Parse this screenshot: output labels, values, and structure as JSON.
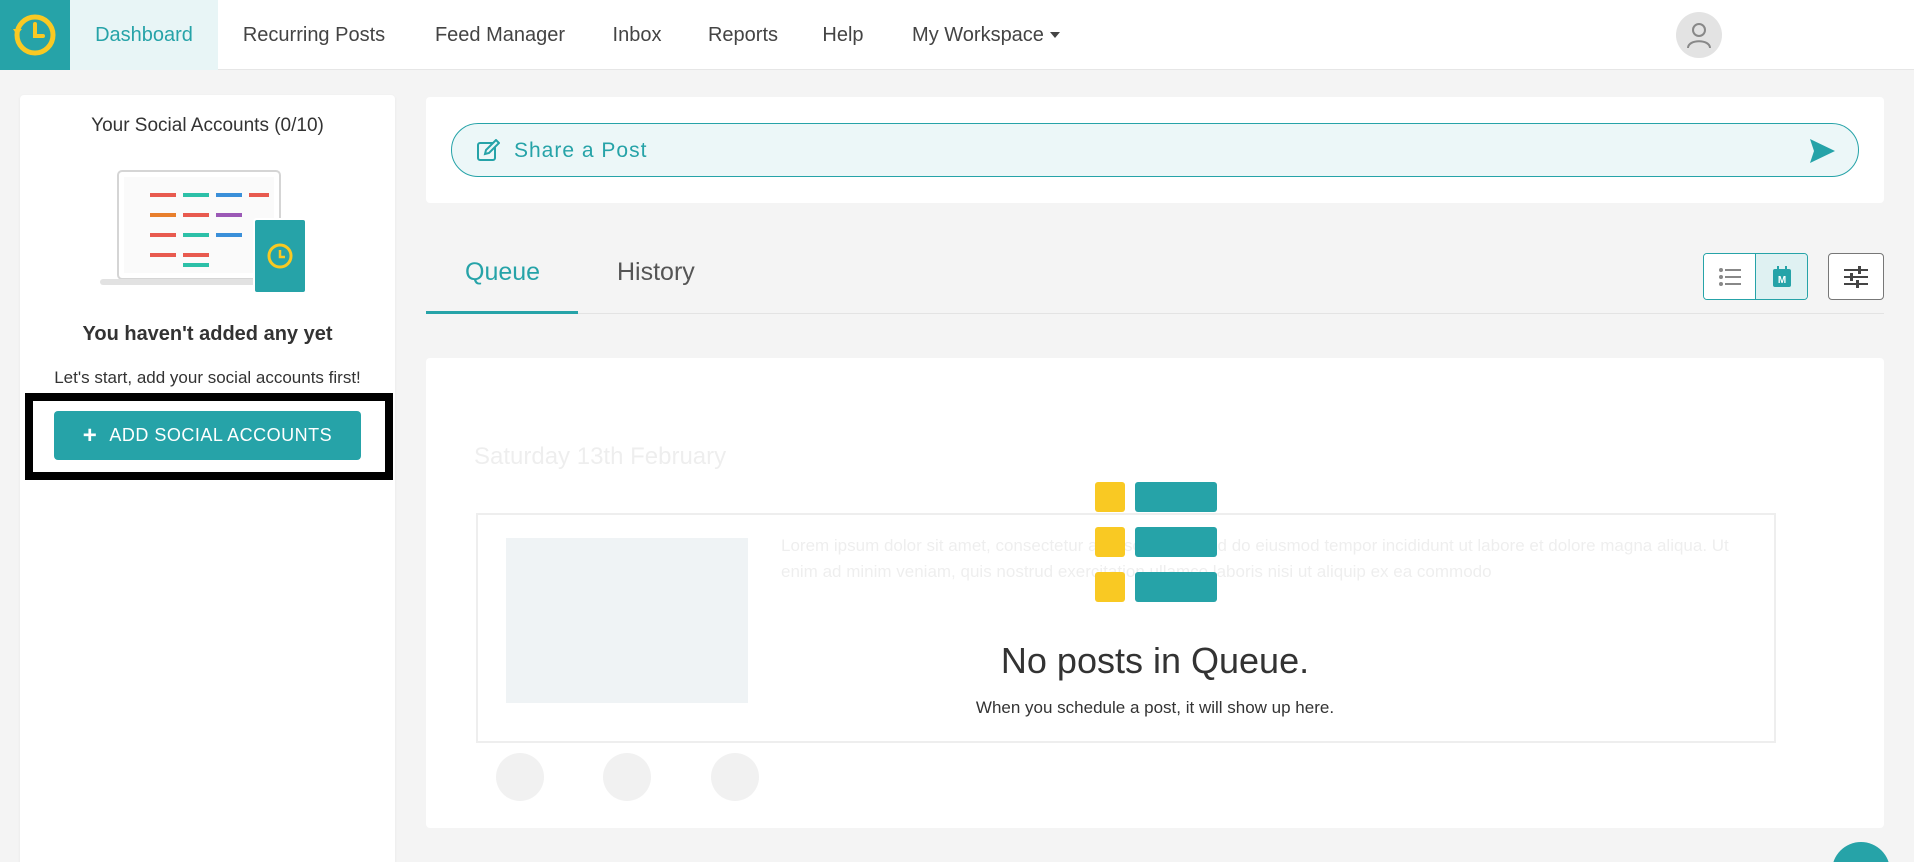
{
  "colors": {
    "accent": "#26a3a8",
    "yellow": "#f9c923",
    "highlight_border": "#000000"
  },
  "nav": {
    "logo_icon": "clock-logo-icon",
    "items": [
      {
        "label": "Dashboard"
      },
      {
        "label": "Recurring Posts"
      },
      {
        "label": "Feed Manager"
      },
      {
        "label": "Inbox"
      },
      {
        "label": "Reports"
      },
      {
        "label": "Help"
      },
      {
        "label": "My Workspace"
      }
    ],
    "active": "Dashboard",
    "avatar_icon": "user-avatar-icon"
  },
  "sidebar": {
    "title": "Your Social Accounts (0/10)",
    "empty_title": "You haven't added any yet",
    "hint": "Let's start, add your social accounts first!",
    "add_button": "ADD SOCIAL ACCOUNTS"
  },
  "share": {
    "label": "Share a Post",
    "pen_icon": "edit-icon",
    "send_icon": "send-icon"
  },
  "tabs": [
    {
      "label": "Queue",
      "active": true
    },
    {
      "label": "History",
      "active": false
    }
  ],
  "view_toggle": {
    "list_icon": "list-view-icon",
    "calendar_icon": "calendar-view-icon",
    "calendar_letter": "M",
    "filter_icon": "sliders-icon"
  },
  "queue": {
    "empty_title": "No posts in Queue.",
    "empty_subtitle": "When you schedule a post, it will show up here.",
    "ghost_date": "Saturday 13th February",
    "ghost_text": "Lorem ipsum dolor sit amet, consectetur adipiscing elit, sed do eiusmod tempor incididunt ut labore et dolore magna aliqua. Ut enim ad minim veniam, quis nostrud exercitation ullamco laboris nisi ut aliquip ex ea commodo"
  }
}
